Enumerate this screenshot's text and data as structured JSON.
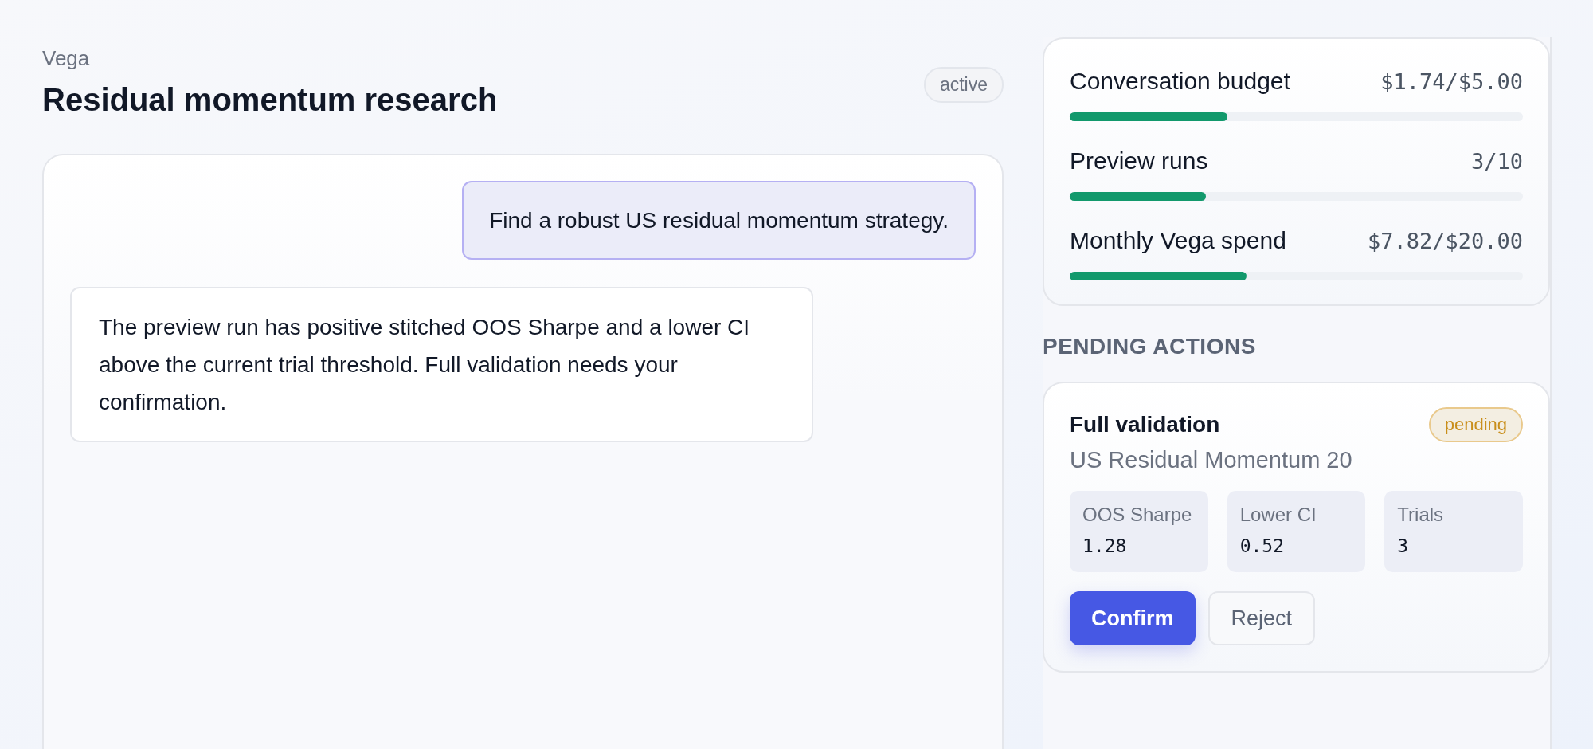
{
  "header": {
    "app_name": "Vega",
    "title": "Residual momentum research",
    "status": "active"
  },
  "messages": [
    {
      "kind": "user",
      "text": "Find a robust US residual momentum strategy."
    },
    {
      "kind": "assistant",
      "text": "The preview run has positive stitched OOS Sharpe and a lower CI above the current trial threshold. Full validation needs your confirmation."
    }
  ],
  "budgets": [
    {
      "label": "Conversation budget",
      "reading": "$1.74/$5.00",
      "level": 0.348
    },
    {
      "label": "Preview runs",
      "reading": "3/10",
      "level": 0.3
    },
    {
      "label": "Monthly Vega spend",
      "reading": "$7.82/$20.00",
      "level": 0.391
    }
  ],
  "pending_actions": {
    "heading": "PENDING ACTIONS",
    "items": [
      {
        "title": "Full validation",
        "status": "pending",
        "subtitle": "US Residual Momentum 20",
        "metrics": [
          {
            "label": "OOS Sharpe",
            "value": "1.28"
          },
          {
            "label": "Lower CI",
            "value": "0.52"
          },
          {
            "label": "Trials",
            "value": "3"
          }
        ],
        "buttons": [
          {
            "label": "Confirm",
            "kind": "primary"
          },
          {
            "label": "Reject",
            "kind": "secondary"
          }
        ]
      }
    ]
  }
}
